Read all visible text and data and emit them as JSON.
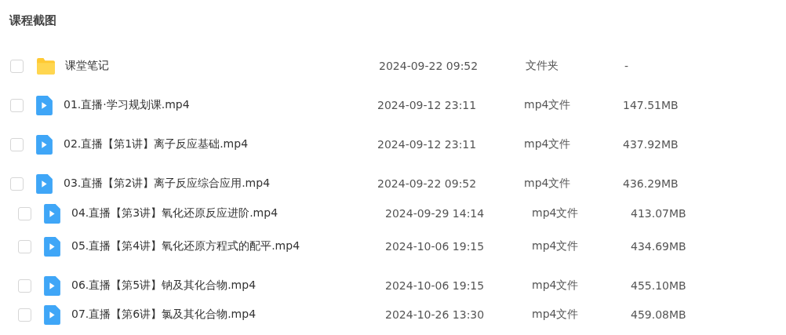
{
  "title": "课程截图",
  "files": [
    {
      "kind": "folder",
      "name": "课堂笔记",
      "modified": "2024-09-22 09:52",
      "type": "文件夹",
      "size": "-",
      "checked": false
    },
    {
      "kind": "video",
      "name": "01.直播·学习规划课.mp4",
      "modified": "2024-09-12 23:11",
      "type": "mp4文件",
      "size": "147.51MB",
      "checked": false
    },
    {
      "kind": "video",
      "name": "02.直播【第1讲】离子反应基础.mp4",
      "modified": "2024-09-12 23:11",
      "type": "mp4文件",
      "size": "437.92MB",
      "checked": false
    },
    {
      "kind": "video",
      "name": "03.直播【第2讲】离子反应综合应用.mp4",
      "modified": "2024-09-22 09:52",
      "type": "mp4文件",
      "size": "436.29MB",
      "checked": false
    },
    {
      "kind": "video",
      "name": "04.直播【第3讲】氧化还原反应进阶.mp4",
      "modified": "2024-09-29 14:14",
      "type": "mp4文件",
      "size": "413.07MB",
      "checked": false
    },
    {
      "kind": "video",
      "name": "05.直播【第4讲】氧化还原方程式的配平.mp4",
      "modified": "2024-10-06 19:15",
      "type": "mp4文件",
      "size": "434.69MB",
      "checked": false
    },
    {
      "kind": "video",
      "name": "06.直播【第5讲】钠及其化合物.mp4",
      "modified": "2024-10-06 19:15",
      "type": "mp4文件",
      "size": "455.10MB",
      "checked": false
    },
    {
      "kind": "video",
      "name": "07.直播【第6讲】氯及其化合物.mp4",
      "modified": "2024-10-26 13:30",
      "type": "mp4文件",
      "size": "459.08MB",
      "checked": false
    }
  ]
}
